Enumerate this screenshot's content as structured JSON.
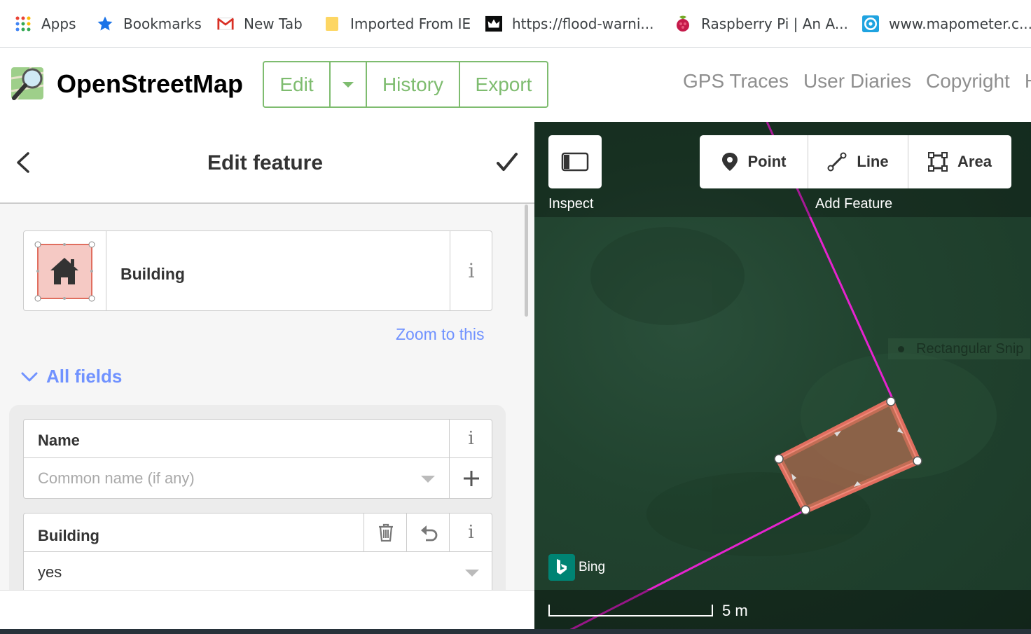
{
  "bookmarks": [
    {
      "label": "Apps",
      "icon": "apps-grid-icon"
    },
    {
      "label": "Bookmarks",
      "icon": "star-icon"
    },
    {
      "label": "New Tab",
      "icon": "gmail-icon"
    },
    {
      "label": "Imported From IE",
      "icon": "folder-icon"
    },
    {
      "label": "https://flood-warni...",
      "icon": "crown-icon"
    },
    {
      "label": "Raspberry Pi | An A...",
      "icon": "raspberry-icon"
    },
    {
      "label": "www.mapometer.c...",
      "icon": "mapometer-icon"
    }
  ],
  "header": {
    "brand": "OpenStreetMap",
    "edit_label": "Edit",
    "history_label": "History",
    "export_label": "Export",
    "links": [
      "GPS Traces",
      "User Diaries",
      "Copyright",
      "He"
    ]
  },
  "sidebar": {
    "title": "Edit feature",
    "preset": {
      "name": "Building",
      "info": "i"
    },
    "zoom_link": "Zoom to this",
    "all_fields": "All fields",
    "fields": [
      {
        "label": "Name",
        "placeholder": "Common name (if any)",
        "value": "",
        "info": "i"
      },
      {
        "label": "Building",
        "value": "yes",
        "info": "i"
      }
    ]
  },
  "map": {
    "inspect_label": "Inspect",
    "add_feature_label": "Add Feature",
    "tools": [
      "Point",
      "Line",
      "Area"
    ],
    "overlay_text": "Rectangular Snip",
    "attribution": "Bing",
    "scale_label": "5 m"
  },
  "colors": {
    "osm_green": "#7ebc6f",
    "link_blue": "#7092ff",
    "way_magenta": "#e623cf",
    "building_fill": "#e06e5f"
  }
}
